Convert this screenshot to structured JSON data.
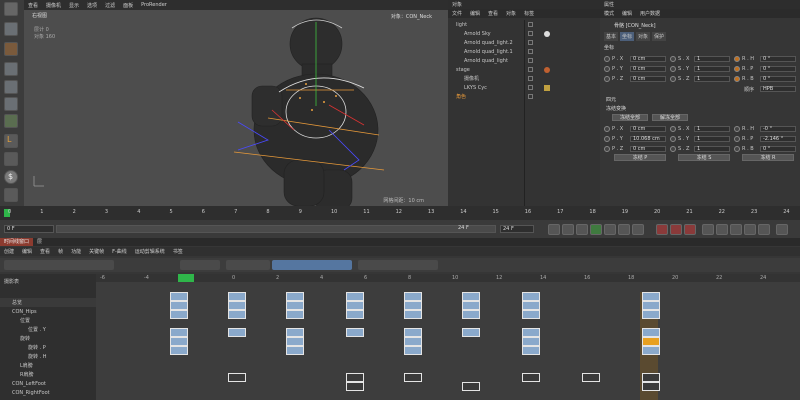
{
  "menu": [
    "查看",
    "摄像机",
    "显示",
    "选项",
    "过滤",
    "面板",
    "ProRender"
  ],
  "viewport": {
    "camera_label": "右视图",
    "info1_label": "层计",
    "info1_value": "0",
    "info2_label": "对象",
    "info2_value": "160",
    "selected": "对象：CON_Neck",
    "grid_info": "网格间距：10 cm"
  },
  "objects_panel": {
    "title": "对象",
    "menu": [
      "文件",
      "编辑",
      "查看",
      "对象",
      "标签"
    ],
    "items": [
      {
        "name": "light"
      },
      {
        "name": "Arnold Sky"
      },
      {
        "name": "Arnold quad_light.2"
      },
      {
        "name": "Arnold quad_light.1"
      },
      {
        "name": "Arnold quad_light"
      },
      {
        "name": "stage"
      },
      {
        "name": "摄像机"
      },
      {
        "name": "LKYS Cyc"
      },
      {
        "name": "角色"
      }
    ]
  },
  "attr_panel": {
    "title": "属性",
    "menu": [
      "模式",
      "编辑",
      "用户数据"
    ],
    "object_line": "骨骼 [CON_Neck]",
    "tabs": [
      "基本",
      "坐标",
      "对象",
      "保护"
    ],
    "section_coord": "坐标",
    "coord_rows": [
      {
        "a": "P . X",
        "av": "0 cm",
        "b": "S . X",
        "bv": "1",
        "c": "R . H",
        "cv": "0 °"
      },
      {
        "a": "P . Y",
        "av": "0 cm",
        "b": "S . Y",
        "bv": "1",
        "c": "R . P",
        "cv": "0 °"
      },
      {
        "a": "P . Z",
        "av": "0 cm",
        "b": "S . Z",
        "bv": "1",
        "c": "R . B",
        "cv": "0 °"
      }
    ],
    "order_label": "顺序",
    "order_value": "HPB",
    "section_quat": "四元",
    "section_freeze": "冻结变换",
    "freeze_all": "冻结全部",
    "unfreeze_all": "解冻全部",
    "freeze_rows": [
      {
        "a": "P . X",
        "av": "0 cm",
        "b": "S . X",
        "bv": "1",
        "c": "R . H",
        "cv": "-0 °"
      },
      {
        "a": "P . Y",
        "av": "10.068 cm",
        "b": "S . Y",
        "bv": "1",
        "c": "R . P",
        "cv": "-2.146 °"
      },
      {
        "a": "P . Z",
        "av": "0 cm",
        "b": "S . Z",
        "bv": "1",
        "c": "R . B",
        "cv": "0 °"
      }
    ],
    "freeze_p": "冻结 P",
    "freeze_s": "冻结 S",
    "freeze_r": "冻结 R"
  },
  "timeline": {
    "ticks": [
      "0",
      "1",
      "2",
      "3",
      "4",
      "5",
      "6",
      "7",
      "8",
      "9",
      "10",
      "11",
      "12",
      "13",
      "14",
      "15",
      "16",
      "17",
      "18",
      "19",
      "20",
      "21",
      "22",
      "23",
      "24"
    ],
    "current_frame": "0 F",
    "end_frame": "24 F",
    "end_frame2": "24 F",
    "end_label": "0 F"
  },
  "dopesheet": {
    "tabs": [
      "时间线窗口",
      "层"
    ],
    "menu": [
      "创建",
      "编辑",
      "查看",
      "帧",
      "功能",
      "关键帧",
      "F-曲线",
      "运动剪辑系统",
      "书签"
    ],
    "ruler": [
      "-6",
      "-4",
      "-2",
      "0",
      "2",
      "4",
      "6",
      "8",
      "10",
      "12",
      "14",
      "16",
      "18",
      "20",
      "22",
      "24",
      "26"
    ],
    "summary_label": "摄影表",
    "rows": [
      {
        "label": "总览"
      },
      {
        "label": "CON_Hips"
      },
      {
        "label": "位置"
      },
      {
        "label": "位置 . Y"
      },
      {
        "label": "旋转"
      },
      {
        "label": "旋转 . P"
      },
      {
        "label": "旋转 . H"
      },
      {
        "label": "L肩膀"
      },
      {
        "label": "R肩膀"
      },
      {
        "label": "CON_LeftFoot"
      },
      {
        "label": "CON_RightFoot"
      }
    ]
  }
}
